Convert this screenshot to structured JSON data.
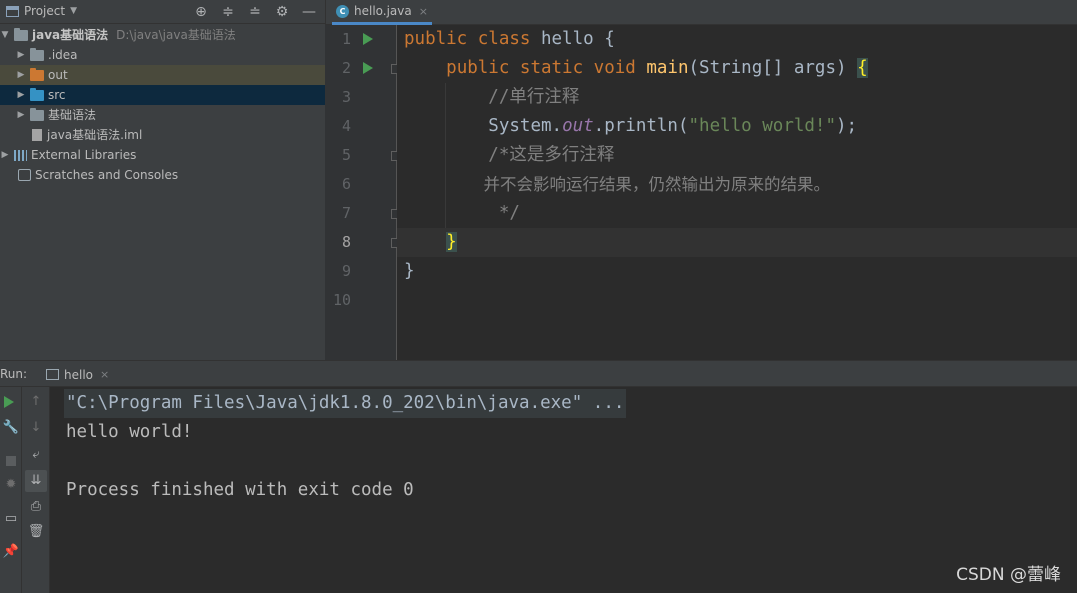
{
  "project_panel": {
    "title": "Project",
    "toolbar_icons": [
      "crosshair-icon",
      "expand-all-icon",
      "collapse-all-icon",
      "gear-icon",
      "hide-icon"
    ],
    "tree": [
      {
        "label": "java基础语法",
        "path": "D:\\java\\java基础语法",
        "type": "module"
      },
      {
        "label": ".idea",
        "type": "folder"
      },
      {
        "label": "out",
        "type": "folder-orange"
      },
      {
        "label": "src",
        "type": "folder-blue"
      },
      {
        "label": "基础语法",
        "type": "folder"
      },
      {
        "label": "java基础语法.iml",
        "type": "file"
      },
      {
        "label": "External Libraries",
        "type": "library"
      },
      {
        "label": "Scratches and Consoles",
        "type": "scratch"
      }
    ]
  },
  "editor": {
    "tab_label": "hello.java",
    "tab_close": "×",
    "line_numbers": [
      "1",
      "2",
      "3",
      "4",
      "5",
      "6",
      "7",
      "8",
      "9",
      "10"
    ],
    "code": {
      "l1_kw": "public class ",
      "l1_name": "hello ",
      "l1_brace": "{",
      "l2_kw": "public static void ",
      "l2_fn": "main",
      "l2_args": "(String[] args) ",
      "l2_brace": "{",
      "l3": "//单行注释",
      "l4_a": "System.",
      "l4_field": "out",
      "l4_b": ".println(",
      "l4_str": "\"hello world!\"",
      "l4_c": ");",
      "l5": "/*这是多行注释",
      "l6": "并不会影响运行结果，仍然输出为原来的结果。",
      "l7": " */",
      "l8": "}",
      "l9": "}"
    }
  },
  "run_panel": {
    "label": "Run:",
    "tab_label": "hello",
    "tab_close": "×",
    "console": {
      "cmd": "\"C:\\Program Files\\Java\\jdk1.8.0_202\\bin\\java.exe\" ...",
      "out1": "hello world!",
      "out2": "Process finished with exit code 0"
    }
  },
  "watermark": "CSDN @蕾峰",
  "colors": {
    "keyword": "#cc7832",
    "function": "#ffc66d",
    "string": "#6a8759",
    "comment": "#808080",
    "field": "#9876aa",
    "run_green": "#499c54"
  }
}
